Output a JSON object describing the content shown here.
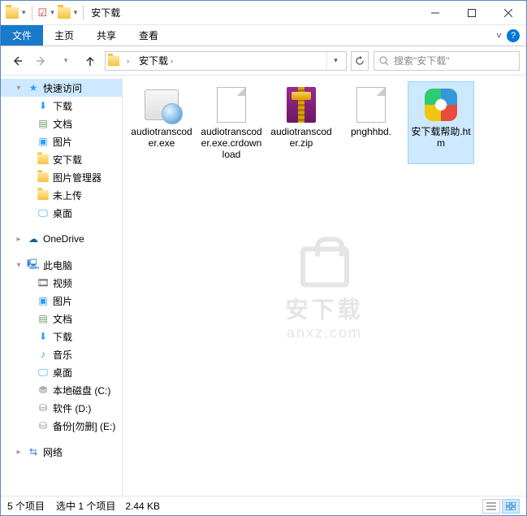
{
  "title": "安下载",
  "ribbon": {
    "file": "文件",
    "tabs": [
      "主页",
      "共享",
      "查看"
    ]
  },
  "breadcrumb": {
    "segments": [
      "安下载"
    ]
  },
  "search": {
    "placeholder": "搜索\"安下载\""
  },
  "sidebar": {
    "quick_access": "快速访问",
    "quick_items": [
      "下载",
      "文档",
      "图片",
      "安下载",
      "图片管理器",
      "未上传",
      "桌面"
    ],
    "onedrive": "OneDrive",
    "this_pc": "此电脑",
    "pc_items": [
      "视频",
      "图片",
      "文档",
      "下载",
      "音乐",
      "桌面",
      "本地磁盘 (C:)",
      "软件 (D:)",
      "备份[勿删] (E:)"
    ],
    "network": "网络"
  },
  "files": [
    {
      "name": "audiotranscoder.exe",
      "type": "exe"
    },
    {
      "name": "audiotranscoder.exe.crdownload",
      "type": "blank"
    },
    {
      "name": "audiotranscoder.zip",
      "type": "zip"
    },
    {
      "name": "pnghhbd.",
      "type": "blank"
    },
    {
      "name": "安下载帮助.htm",
      "type": "htm"
    }
  ],
  "selected_index": 4,
  "status": {
    "count": "5 个项目",
    "selection": "选中 1 个项目　2.44 KB"
  },
  "watermark": {
    "line1": "安下载",
    "line2": "anxz.com"
  }
}
